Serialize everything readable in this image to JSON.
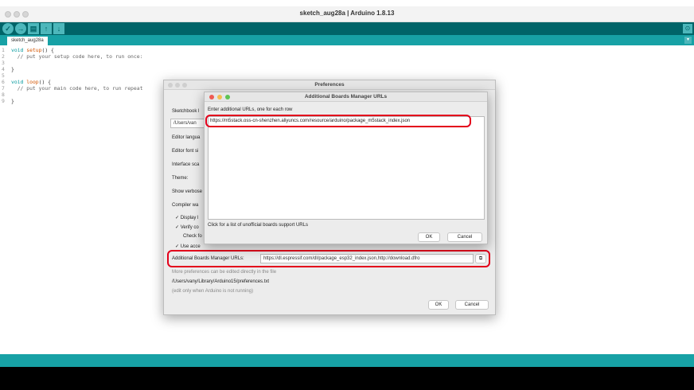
{
  "window": {
    "title": "sketch_aug28a | Arduino 1.8.13"
  },
  "toolbar": {
    "verify_icon": "checkmark-icon",
    "upload_icon": "arrow-right-icon",
    "new_icon": "new-file-icon",
    "open_icon": "open-arrow-icon",
    "save_icon": "save-arrow-icon",
    "serial_icon": "magnifier-icon",
    "verify_glyph": "✓",
    "upload_glyph": "→",
    "new_glyph": "▤",
    "open_glyph": "↑",
    "save_glyph": "↓",
    "serial_glyph": "⊙"
  },
  "tabs": {
    "active": "sketch_aug28a",
    "menu_glyph": "▾"
  },
  "editor": {
    "lines": [
      {
        "n": "1",
        "kw": "void ",
        "fn": "setup",
        "rest": "() {"
      },
      {
        "n": "2",
        "text": "  // put your setup code here, to run once:"
      },
      {
        "n": "3",
        "text": ""
      },
      {
        "n": "4",
        "text": "}"
      },
      {
        "n": "5",
        "text": ""
      },
      {
        "n": "6",
        "kw": "void ",
        "fn": "loop",
        "rest": "() {"
      },
      {
        "n": "7",
        "text": "  // put your main code here, to run repeat"
      },
      {
        "n": "8",
        "text": ""
      },
      {
        "n": "9",
        "text": "}"
      }
    ]
  },
  "preferences": {
    "title": "Preferences",
    "sketchbook_label": "Sketchbook l",
    "sketchbook_value": "/Users/van",
    "editor_language": "Editor langua",
    "editor_font": "Editor font si",
    "interface_scale": "Interface sca",
    "theme": "Theme:",
    "show_verbose": "Show verbose",
    "compiler_warnings": "Compiler wa",
    "check_display": "✓ Display l",
    "check_verify": "✓ Verify co",
    "check_updates": "Check fo",
    "check_accessibility": "✓ Use acce",
    "boards_label": "Additional Boards Manager URLs:",
    "boards_value": "https://dl.espressif.com/dl/package_esp32_index.json,http://download.dfro",
    "boards_button_glyph": "⧉",
    "more_prefs": "More preferences can be edited directly in the file",
    "prefs_path": "/Users/vany/Library/Arduino15/preferences.txt",
    "edit_note": "(edit only when Arduino is not running)",
    "ok": "OK",
    "cancel": "Cancel"
  },
  "urls_dialog": {
    "title": "Additional Boards Manager URLs",
    "instruction": "Enter additional URLs, one for each row",
    "url": "https://m5stack.oss-cn-shenzhen.aliyuncs.com/resource/arduino/package_m5stack_index.json",
    "link_text": "Click for a list of unofficial boards support URLs",
    "ok": "OK",
    "cancel": "Cancel"
  },
  "colors": {
    "toolbar": "#006468",
    "tabbar": "#17a1a5",
    "highlight": "#e3001b"
  }
}
